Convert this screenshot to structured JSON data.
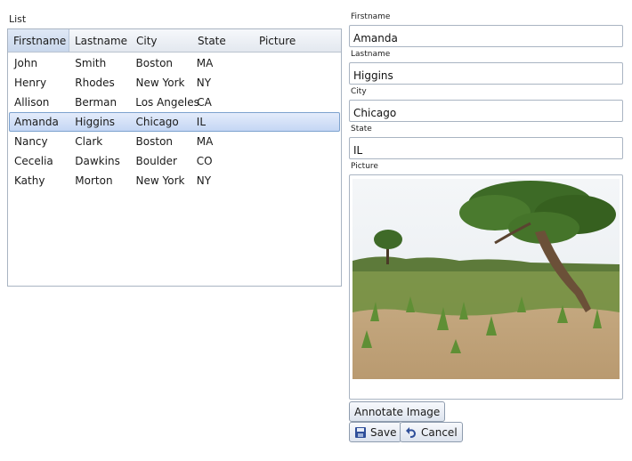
{
  "list": {
    "caption": "List",
    "columns": [
      "Firstname",
      "Lastname",
      "City",
      "State",
      "Picture"
    ],
    "rows": [
      {
        "firstname": "John",
        "lastname": "Smith",
        "city": "Boston",
        "state": "MA",
        "picture": ""
      },
      {
        "firstname": "Henry",
        "lastname": "Rhodes",
        "city": "New York",
        "state": "NY",
        "picture": ""
      },
      {
        "firstname": "Allison",
        "lastname": "Berman",
        "city": "Los Angeles",
        "state": "CA",
        "picture": ""
      },
      {
        "firstname": "Amanda",
        "lastname": "Higgins",
        "city": "Chicago",
        "state": "IL",
        "picture": ""
      },
      {
        "firstname": "Nancy",
        "lastname": "Clark",
        "city": "Boston",
        "state": "MA",
        "picture": ""
      },
      {
        "firstname": "Cecelia",
        "lastname": "Dawkins",
        "city": "Boulder",
        "state": "CO",
        "picture": ""
      },
      {
        "firstname": "Kathy",
        "lastname": "Morton",
        "city": "New York",
        "state": "NY",
        "picture": ""
      }
    ],
    "selected_index": 3
  },
  "detail": {
    "firstname": {
      "label": "Firstname",
      "value": "Amanda"
    },
    "lastname": {
      "label": "Lastname",
      "value": "Higgins"
    },
    "city": {
      "label": "City",
      "value": "Chicago"
    },
    "state": {
      "label": "State",
      "value": "IL"
    },
    "picture": {
      "label": "Picture"
    }
  },
  "actions": {
    "annotate_label": "Annotate Image",
    "save_label": "Save",
    "cancel_label": "Cancel"
  },
  "icons": {
    "save": "floppy-disk-icon",
    "cancel": "undo-arrow-icon"
  },
  "colors": {
    "selection": "#c4d6f4",
    "border": "#a9b4c2",
    "header": "#e3e8ef"
  }
}
